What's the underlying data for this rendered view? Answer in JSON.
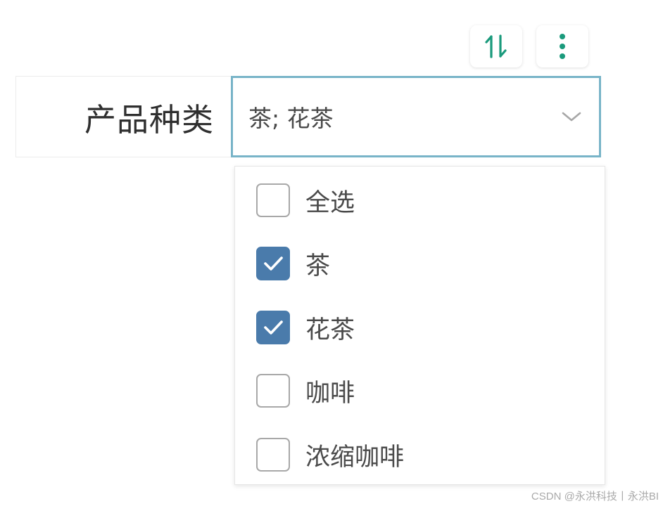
{
  "toolbar": {
    "sort_icon": "sort-arrows-icon",
    "more_icon": "vertical-dots-icon",
    "accent_color": "#1a9a7c"
  },
  "filter": {
    "label": "产品种类",
    "selected_value": "茶; 花茶",
    "focus_border_color": "#78b4c8",
    "dropdown_icon": "chevron-down-icon"
  },
  "options": [
    {
      "label": "全选",
      "checked": false
    },
    {
      "label": "茶",
      "checked": true
    },
    {
      "label": "花茶",
      "checked": true
    },
    {
      "label": "咖啡",
      "checked": false
    },
    {
      "label": "浓缩咖啡",
      "checked": false
    }
  ],
  "checkbox_checked_color": "#4a7bab",
  "watermark": "CSDN @永洪科技丨永洪BI"
}
